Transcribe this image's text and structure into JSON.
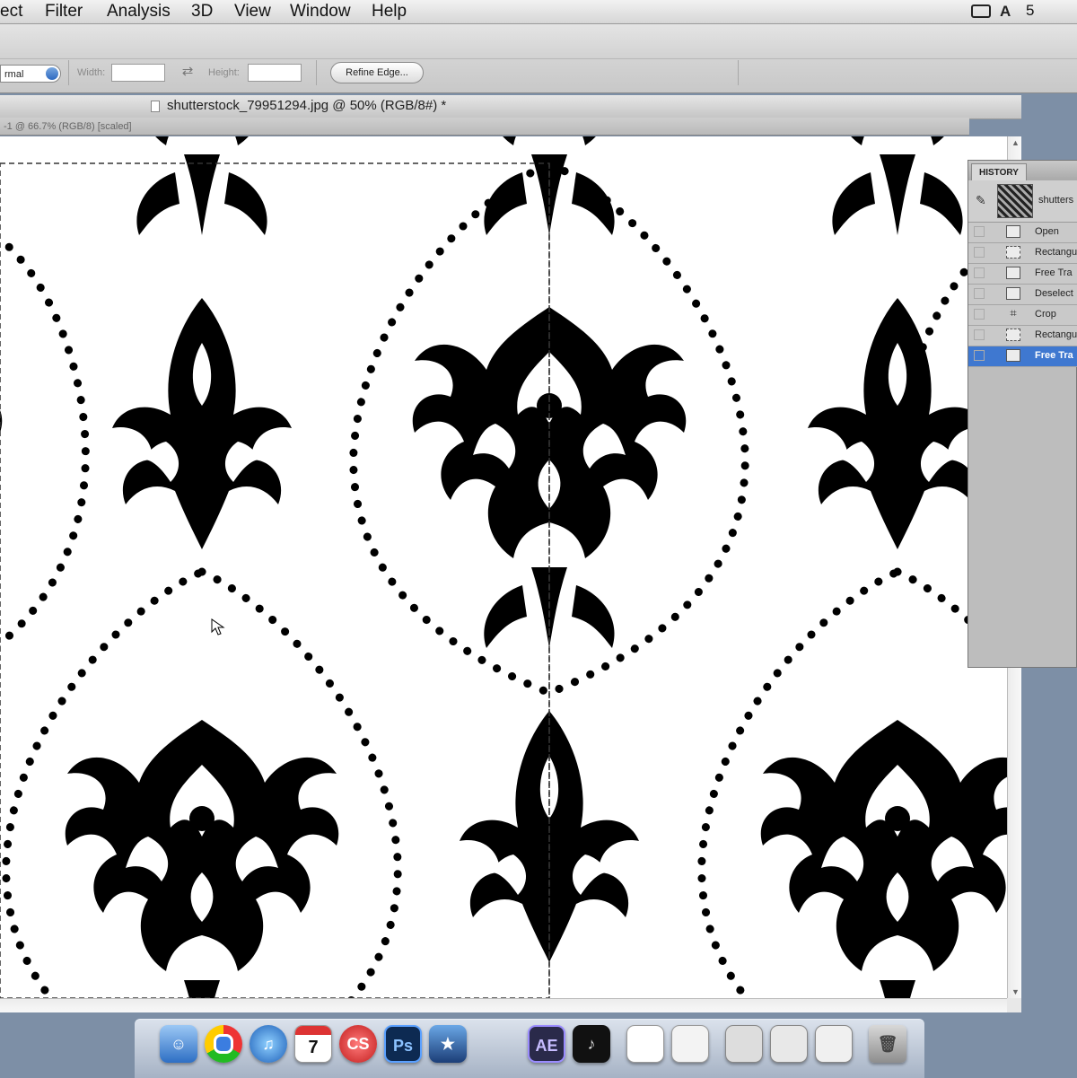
{
  "menubar": {
    "items": [
      "ect",
      "Filter",
      "Analysis",
      "3D",
      "View",
      "Window",
      "Help"
    ],
    "status": "5"
  },
  "options": {
    "style_value": "rmal",
    "width_label": "Width:",
    "height_label": "Height:",
    "refine_edge_label": "Refine Edge..."
  },
  "document": {
    "front_title": "shutterstock_79951294.jpg @ 50% (RGB/8#) *",
    "back_title": "-1 @ 66.7% (RGB/8) [scaled]"
  },
  "history": {
    "tab_label": "HISTORY",
    "snapshot_label": "shutters",
    "steps": [
      {
        "label": "Open",
        "icon": "document-icon"
      },
      {
        "label": "Rectangu",
        "icon": "marquee-icon"
      },
      {
        "label": "Free Tra",
        "icon": "transform-icon"
      },
      {
        "label": "Deselect",
        "icon": "deselect-icon"
      },
      {
        "label": "Crop",
        "icon": "crop-icon"
      },
      {
        "label": "Rectangu",
        "icon": "marquee-icon"
      },
      {
        "label": "Free Tra",
        "icon": "transform-icon",
        "selected": true
      }
    ]
  },
  "dock": {
    "calendar_day": "7",
    "apps": [
      "Finder",
      "Chrome",
      "iTunes",
      "iCal",
      "Creative Suite",
      "Photoshop",
      "iMovie",
      "After Effects",
      "Music"
    ],
    "ps_label": "Ps",
    "ae_label": "AE",
    "cs_label": "CS"
  }
}
